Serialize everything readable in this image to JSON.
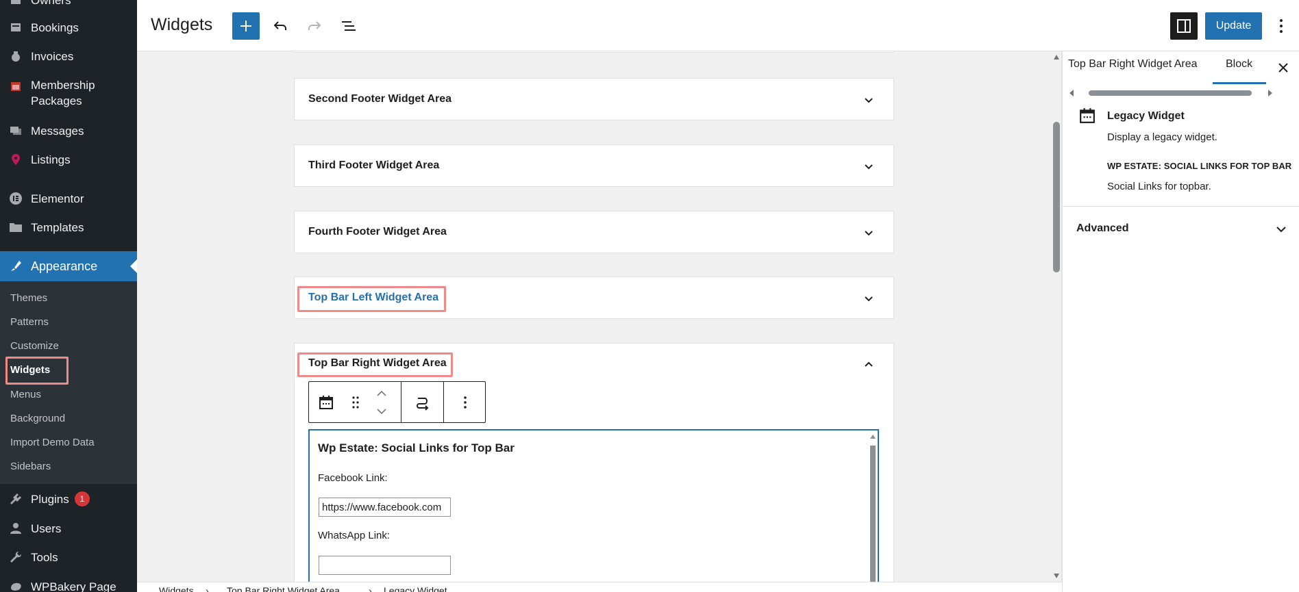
{
  "header": {
    "title": "Widgets",
    "update_label": "Update"
  },
  "admin_menu": {
    "owners": "Owners",
    "bookings": "Bookings",
    "invoices": "Invoices",
    "membership": "Membership Packages",
    "messages": "Messages",
    "listings": "Listings",
    "elementor": "Elementor",
    "templates": "Templates",
    "appearance": "Appearance",
    "plugins": "Plugins",
    "plugins_badge": "1",
    "users": "Users",
    "tools": "Tools",
    "wpbakery": "WPBakery Page"
  },
  "appearance_submenu": {
    "themes": "Themes",
    "patterns": "Patterns",
    "customize": "Customize",
    "widgets": "Widgets",
    "menus": "Menus",
    "background": "Background",
    "import_demo": "Import Demo Data",
    "sidebars": "Sidebars"
  },
  "widget_areas": [
    {
      "title": "Second Footer Widget Area"
    },
    {
      "title": "Third Footer Widget Area"
    },
    {
      "title": "Fourth Footer Widget Area"
    },
    {
      "title": "Top Bar Left Widget Area"
    },
    {
      "title": "Top Bar Right Widget Area"
    }
  ],
  "legacy_widget_form": {
    "title": "Wp Estate: Social Links for Top Bar",
    "facebook_label": "Facebook Link:",
    "facebook_value": "https://www.facebook.com",
    "whatsapp_label": "WhatsApp Link:",
    "whatsapp_value": ""
  },
  "breadcrumb": {
    "item1": "Widgets",
    "item2": "Top Bar Right Widget Area",
    "item3": "Legacy Widget"
  },
  "settings_sidebar": {
    "tab_area": "Top Bar Right Widget Area",
    "tab_block": "Block",
    "block_title": "Legacy Widget",
    "block_desc": "Display a legacy widget.",
    "widget_name": "WP ESTATE: SOCIAL LINKS FOR TOP BAR",
    "widget_desc": "Social Links for topbar.",
    "advanced": "Advanced"
  },
  "colors": {
    "accent": "#2271b1",
    "sidebar_bg": "#1d2327",
    "highlight_box": "#f08a8a",
    "badge": "#d63638"
  }
}
